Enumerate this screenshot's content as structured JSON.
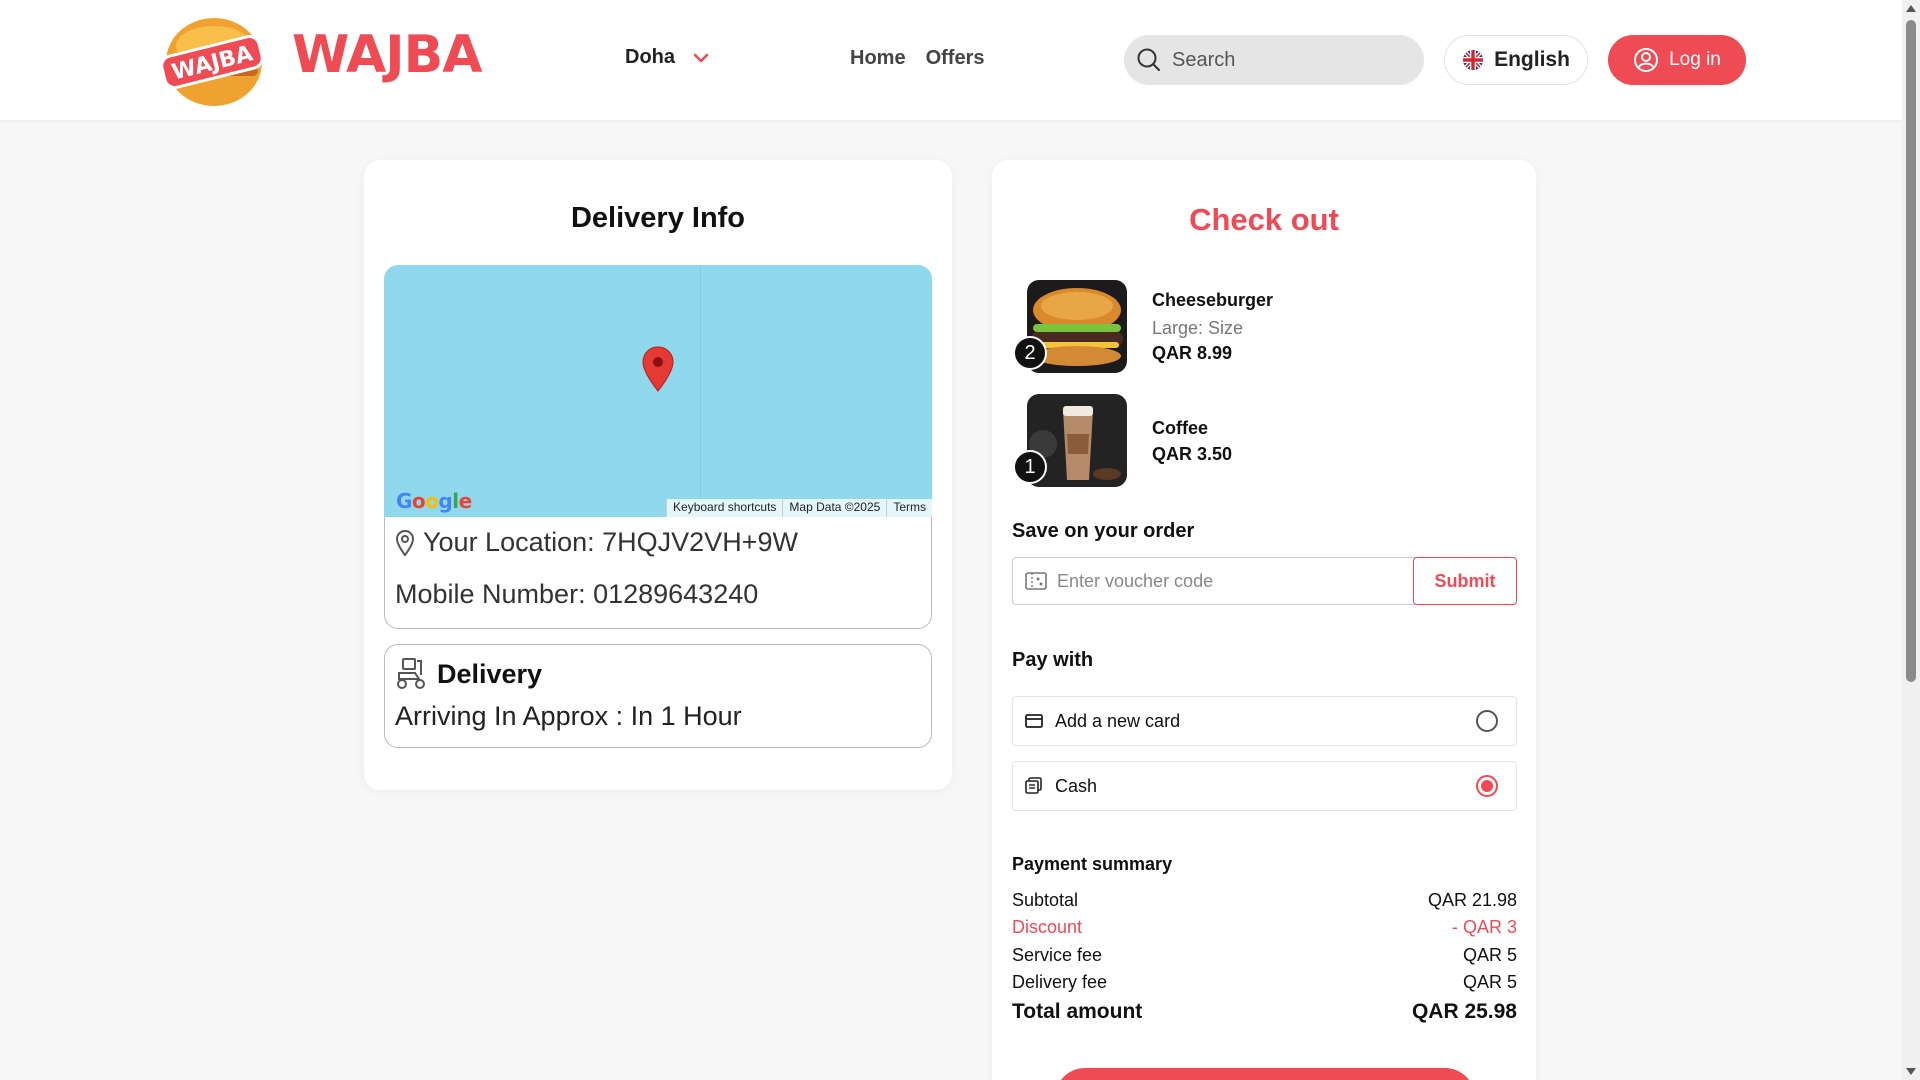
{
  "header": {
    "brand": "WAJBA",
    "logo_text": "WAJBA",
    "city": "Doha",
    "nav": [
      "Home",
      "Offers"
    ],
    "search_placeholder": "Search",
    "language": "English",
    "login_label": "Log in",
    "accent_color": "#ef4b55"
  },
  "delivery": {
    "title": "Delivery Info",
    "map": {
      "logo": "Google",
      "footer": [
        "Keyboard shortcuts",
        "Map Data ©2025",
        "Terms"
      ]
    },
    "location": "Your Location: 7HQJV2VH+9W",
    "mobile": "Mobile Number: 01289643240",
    "mode_title": "Delivery",
    "eta": "Arriving In Approx : In 1 Hour"
  },
  "checkout": {
    "title": "Check out",
    "items": [
      {
        "name": "Cheeseburger",
        "size": "Large: Size",
        "price": "QAR 8.99",
        "qty": "2",
        "image_icon": "burger-photo"
      },
      {
        "name": "Coffee",
        "price": "QAR 3.50",
        "qty": "1",
        "image_icon": "iced-coffee-photo"
      }
    ],
    "voucher": {
      "label": "Save on your order",
      "placeholder": "Enter voucher code",
      "submit": "Submit"
    },
    "pay": {
      "label": "Pay with",
      "options": [
        {
          "label": "Add a new card",
          "icon": "card-icon",
          "selected": false
        },
        {
          "label": "Cash",
          "icon": "cash-icon",
          "selected": true
        }
      ]
    },
    "summary": {
      "title": "Payment summary",
      "rows": [
        {
          "label": "Subtotal",
          "value": "QAR 21.98"
        },
        {
          "label": "Discount",
          "value": "- QAR 3"
        },
        {
          "label": "Service fee",
          "value": "QAR 5"
        },
        {
          "label": "Delivery fee",
          "value": "QAR 5"
        }
      ],
      "total_label": "Total amount",
      "total_value": "QAR 25.98"
    }
  }
}
